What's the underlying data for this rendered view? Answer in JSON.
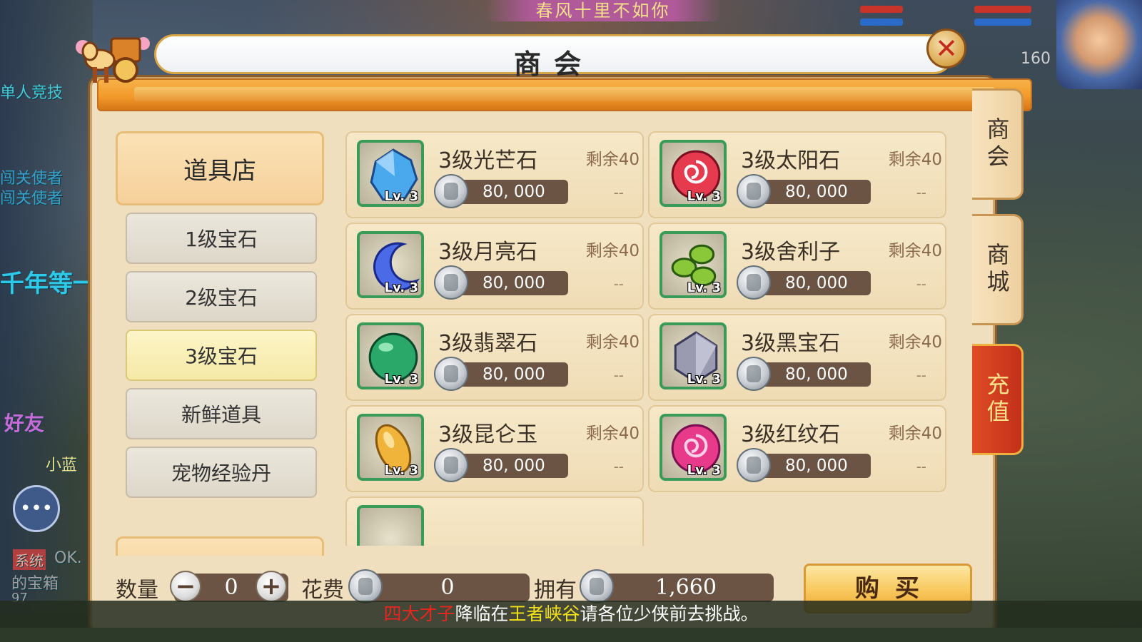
{
  "background": {
    "top_banner": "春风十里不如你",
    "left_texts": [
      "单人竞技",
      "闯关使者",
      "闯关使者",
      "千年等一",
      "好友",
      "小蓝",
      "系统",
      "OK.",
      "的宝箱",
      "97"
    ],
    "player_level": "160"
  },
  "dialog": {
    "title": "商会",
    "close_icon": "close-icon"
  },
  "left_menu": {
    "category": "道具店",
    "items": [
      {
        "label": "1级宝石",
        "active": false
      },
      {
        "label": "2级宝石",
        "active": false
      },
      {
        "label": "3级宝石",
        "active": true
      },
      {
        "label": "新鲜道具",
        "active": false
      },
      {
        "label": "宠物经验丹",
        "active": false
      }
    ]
  },
  "items": [
    {
      "name": "3级光芒石",
      "remain": "剩余40",
      "price": "80, 000",
      "level": "Lv. 3",
      "icon": "blue-crystal-icon",
      "color": "#4aa8ec",
      "dash": "--"
    },
    {
      "name": "3级太阳石",
      "remain": "剩余40",
      "price": "80, 000",
      "level": "Lv. 3",
      "icon": "red-swirl-orb-icon",
      "color": "#e63a4e",
      "dash": "--"
    },
    {
      "name": "3级月亮石",
      "remain": "剩余40",
      "price": "80, 000",
      "level": "Lv. 3",
      "icon": "crescent-moon-icon",
      "color": "#4a6ae8",
      "dash": "--"
    },
    {
      "name": "3级舍利子",
      "remain": "剩余40",
      "price": "80, 000",
      "level": "Lv. 3",
      "icon": "green-beads-icon",
      "color": "#8ac83a",
      "dash": "--"
    },
    {
      "name": "3级翡翠石",
      "remain": "剩余40",
      "price": "80, 000",
      "level": "Lv. 3",
      "icon": "jade-orb-icon",
      "color": "#2aa86a",
      "dash": "--"
    },
    {
      "name": "3级黑宝石",
      "remain": "剩余40",
      "price": "80, 000",
      "level": "Lv. 3",
      "icon": "diamond-icon",
      "color": "#9a9ab0",
      "dash": "--"
    },
    {
      "name": "3级昆仑玉",
      "remain": "剩余40",
      "price": "80, 000",
      "level": "Lv. 3",
      "icon": "gold-jade-icon",
      "color": "#f0b43a",
      "dash": "--"
    },
    {
      "name": "3级红纹石",
      "remain": "剩余40",
      "price": "80, 000",
      "level": "Lv. 3",
      "icon": "pink-swirl-orb-icon",
      "color": "#e83a8a",
      "dash": "--"
    }
  ],
  "bottom_bar": {
    "quantity_label": "数量",
    "quantity_value": "0",
    "minus": "−",
    "plus": "+",
    "cost_label": "花费",
    "cost_value": "0",
    "own_label": "拥有",
    "own_value": "1,660",
    "buy_label": "购买"
  },
  "side_tabs": [
    {
      "label": "商会"
    },
    {
      "label": "商城"
    },
    {
      "label": "充值"
    }
  ],
  "announcement": {
    "part1": "四大才子",
    "part2": "降临在",
    "part3": "王者峡谷",
    "part4": "请各位少侠前去挑战。"
  }
}
